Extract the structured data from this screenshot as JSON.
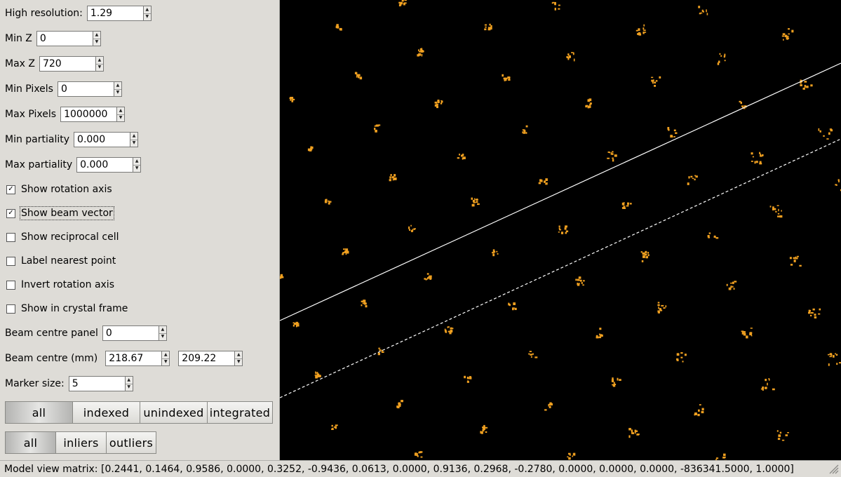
{
  "controls": {
    "high_resolution": {
      "label": "High resolution:",
      "value": "1.29"
    },
    "min_z": {
      "label": "Min Z",
      "value": "0"
    },
    "max_z": {
      "label": "Max Z",
      "value": "720"
    },
    "min_pixels": {
      "label": "Min Pixels",
      "value": "0"
    },
    "max_pixels": {
      "label": "Max Pixels",
      "value": "1000000"
    },
    "min_partiality": {
      "label": "Min partiality",
      "value": "0.000"
    },
    "max_partiality": {
      "label": "Max partiality",
      "value": "0.000"
    },
    "beam_centre_panel": {
      "label": "Beam centre panel",
      "value": "0"
    },
    "beam_centre_mm": {
      "label": "Beam centre (mm)",
      "x": "218.67",
      "y": "209.22"
    },
    "marker_size": {
      "label": "Marker size:",
      "value": "5"
    }
  },
  "checkboxes": [
    {
      "label": "Show rotation axis",
      "checked": true
    },
    {
      "label": "Show beam vector",
      "checked": true
    },
    {
      "label": "Show reciprocal cell",
      "checked": false
    },
    {
      "label": "Label nearest point",
      "checked": false
    },
    {
      "label": "Invert rotation axis",
      "checked": false
    },
    {
      "label": "Show in crystal frame",
      "checked": false
    }
  ],
  "filter_buttons": [
    "all",
    "indexed",
    "unindexed",
    "integrated"
  ],
  "filter_selected": "all",
  "outlier_buttons": [
    "all",
    "inliers",
    "outliers"
  ],
  "outlier_selected": "all",
  "status_bar": "Model view matrix: [0.2441, 0.1464, 0.9586, 0.0000, 0.3252, -0.9436, 0.0613, 0.0000, 0.9136, 0.2968, -0.2780, 0.0000, 0.0000, 0.0000, -836341.5000, 1.0000]",
  "colors": {
    "spot": "#f0a020",
    "background": "#000000",
    "lines": "#ffffff"
  }
}
